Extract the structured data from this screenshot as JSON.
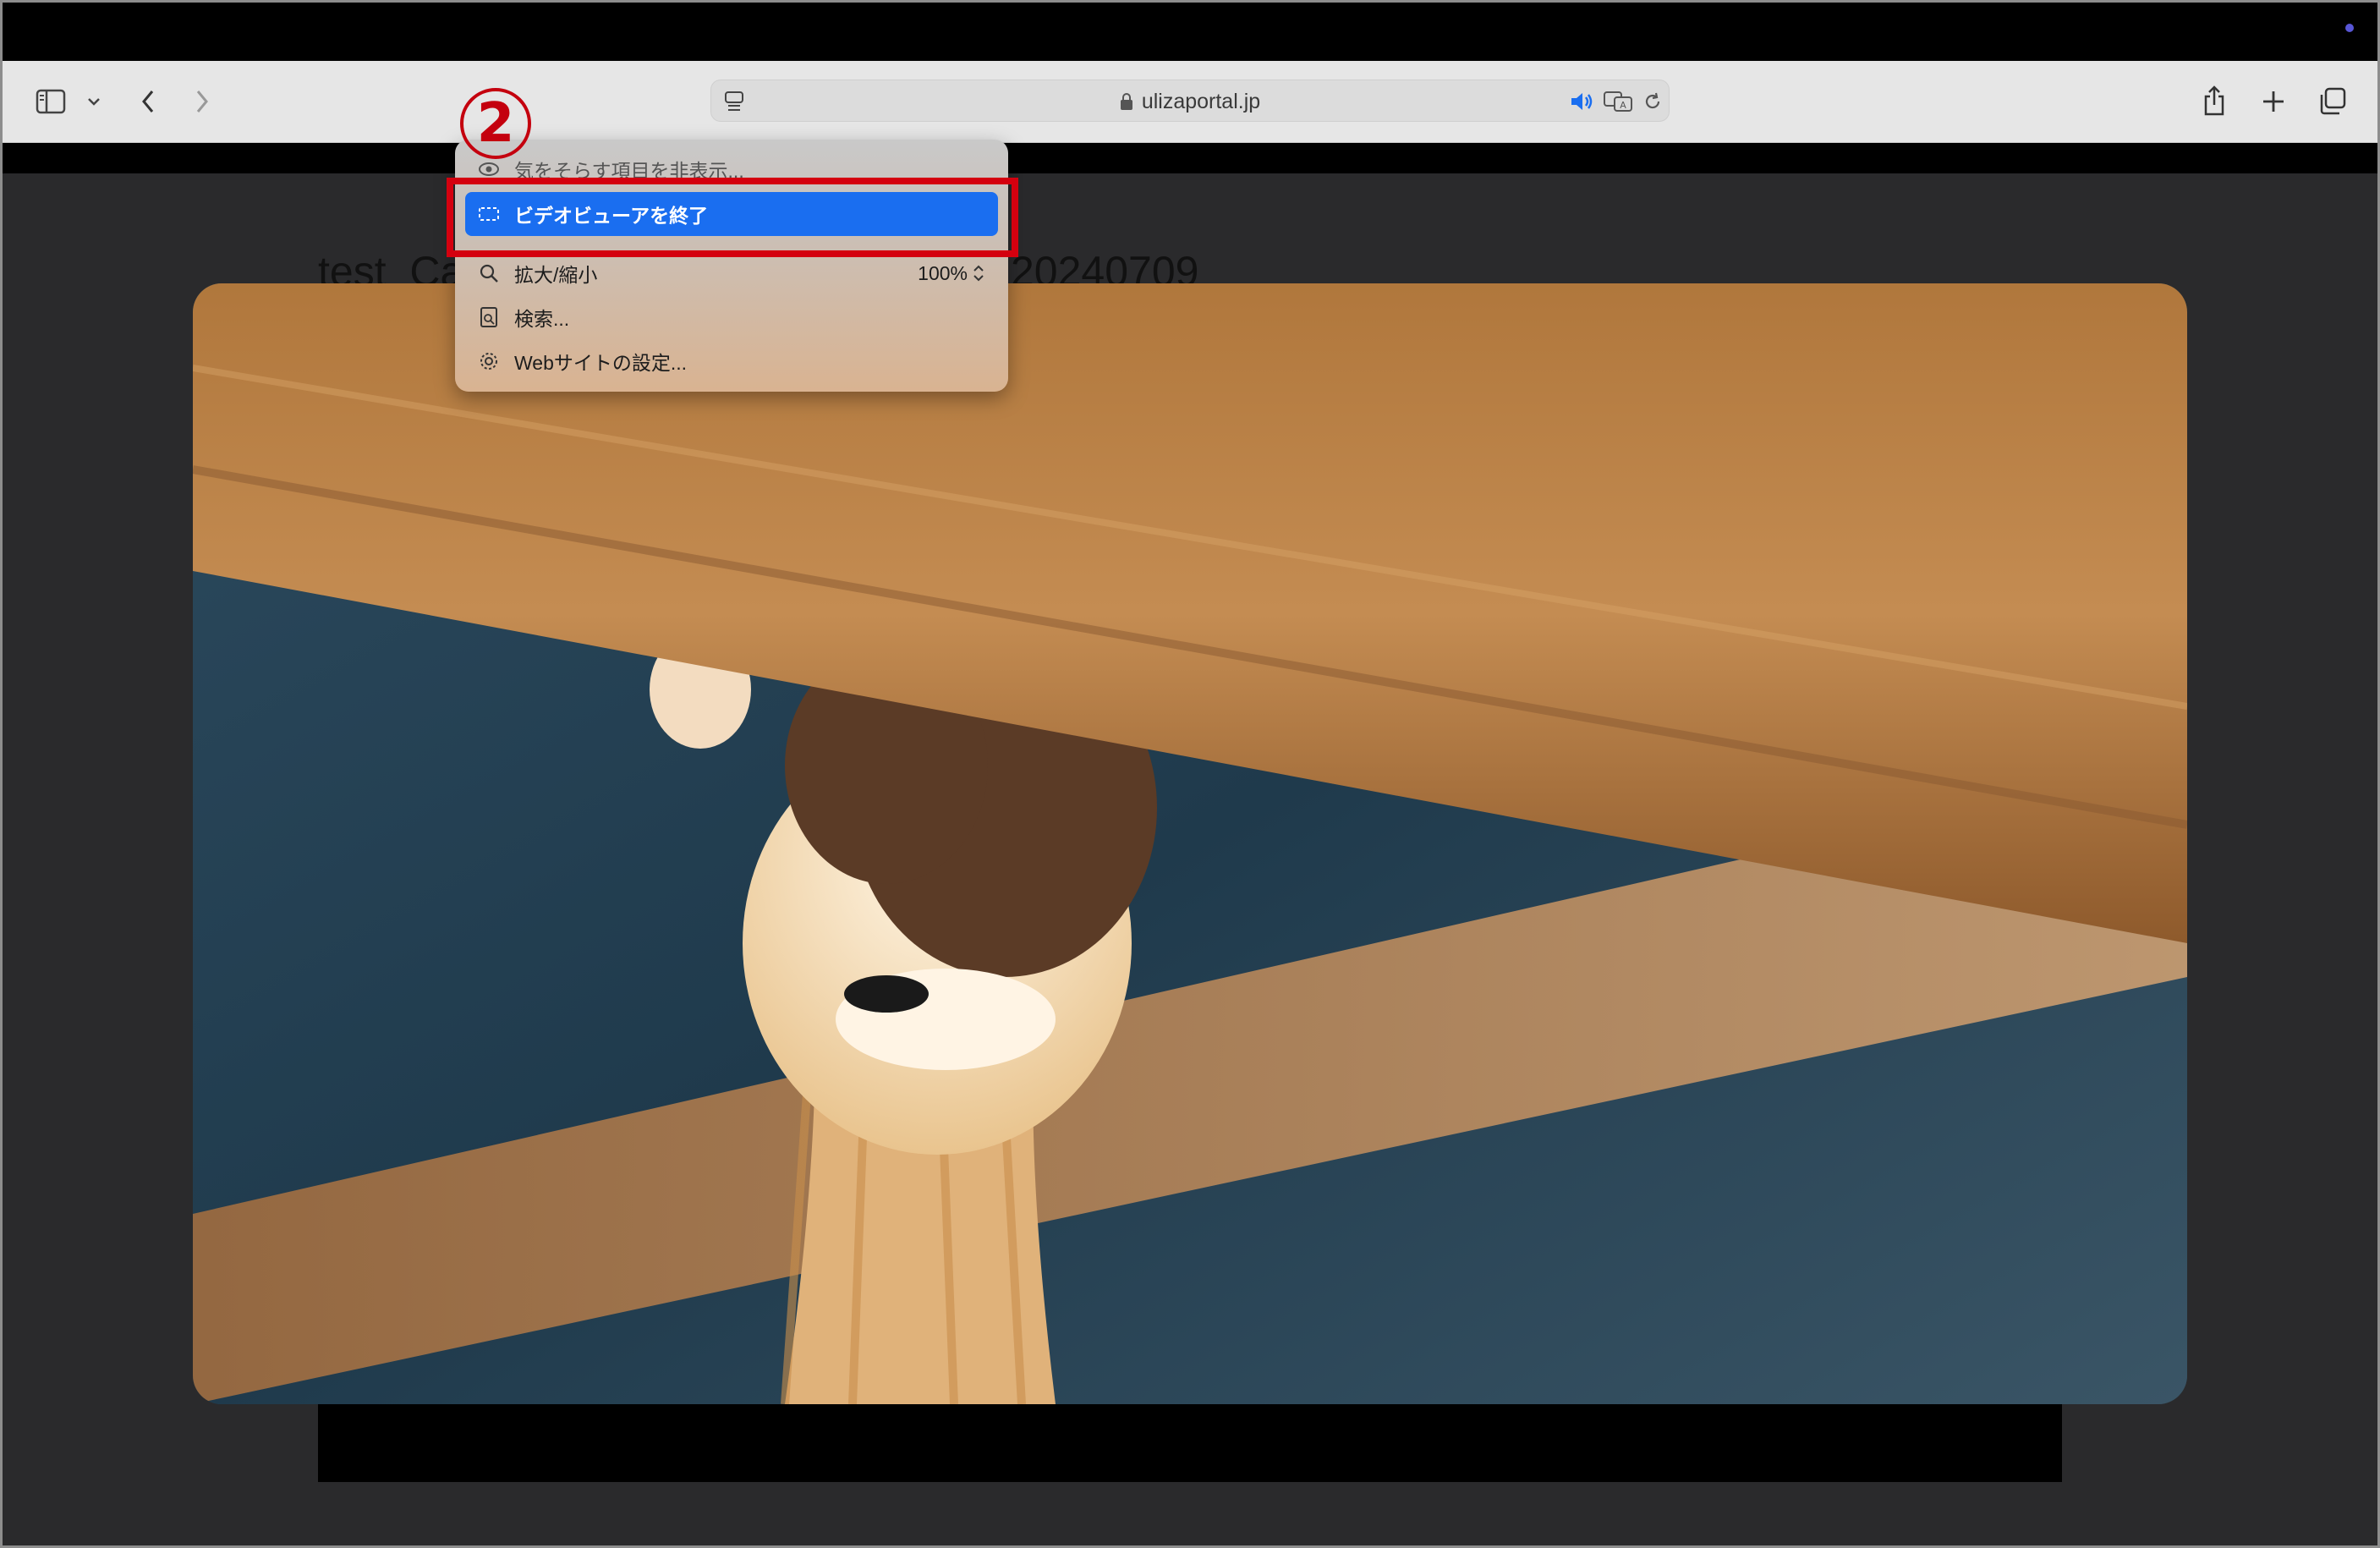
{
  "browser": {
    "url": "ulizaportal.jp",
    "icons": {
      "sidebar": "sidebar-icon",
      "sidebar_menu": "chevron-down-icon",
      "back": "back-chevron-icon",
      "forward": "forward-chevron-icon",
      "page_menu": "page-menu-icon",
      "lock": "lock-icon",
      "audio": "speaker-icon",
      "translate": "translate-icon",
      "reload": "reload-icon",
      "share": "share-icon",
      "new_tab": "plus-icon",
      "tabs": "tab-overview-icon"
    }
  },
  "page": {
    "title_start": "test_Ca",
    "title_end": "20240709"
  },
  "menu": {
    "items": [
      {
        "label": "気をそらす項目を非表示...",
        "icon": "eye-slash-icon"
      },
      {
        "label": "ビデオビューアを終了",
        "icon": "video-viewer-icon",
        "selected": true
      },
      {
        "label": "拡大/縮小",
        "icon": "magnifier-icon",
        "value": "100%"
      },
      {
        "label": "検索...",
        "icon": "find-icon"
      },
      {
        "label": "Webサイトの設定...",
        "icon": "gear-icon"
      }
    ]
  },
  "annotation": {
    "step_number": "2",
    "highlight_color": "#d4000f"
  },
  "colors": {
    "selection": "#1a6ef0",
    "menubar": "#000000",
    "toolbar": "#e6e6e6"
  }
}
